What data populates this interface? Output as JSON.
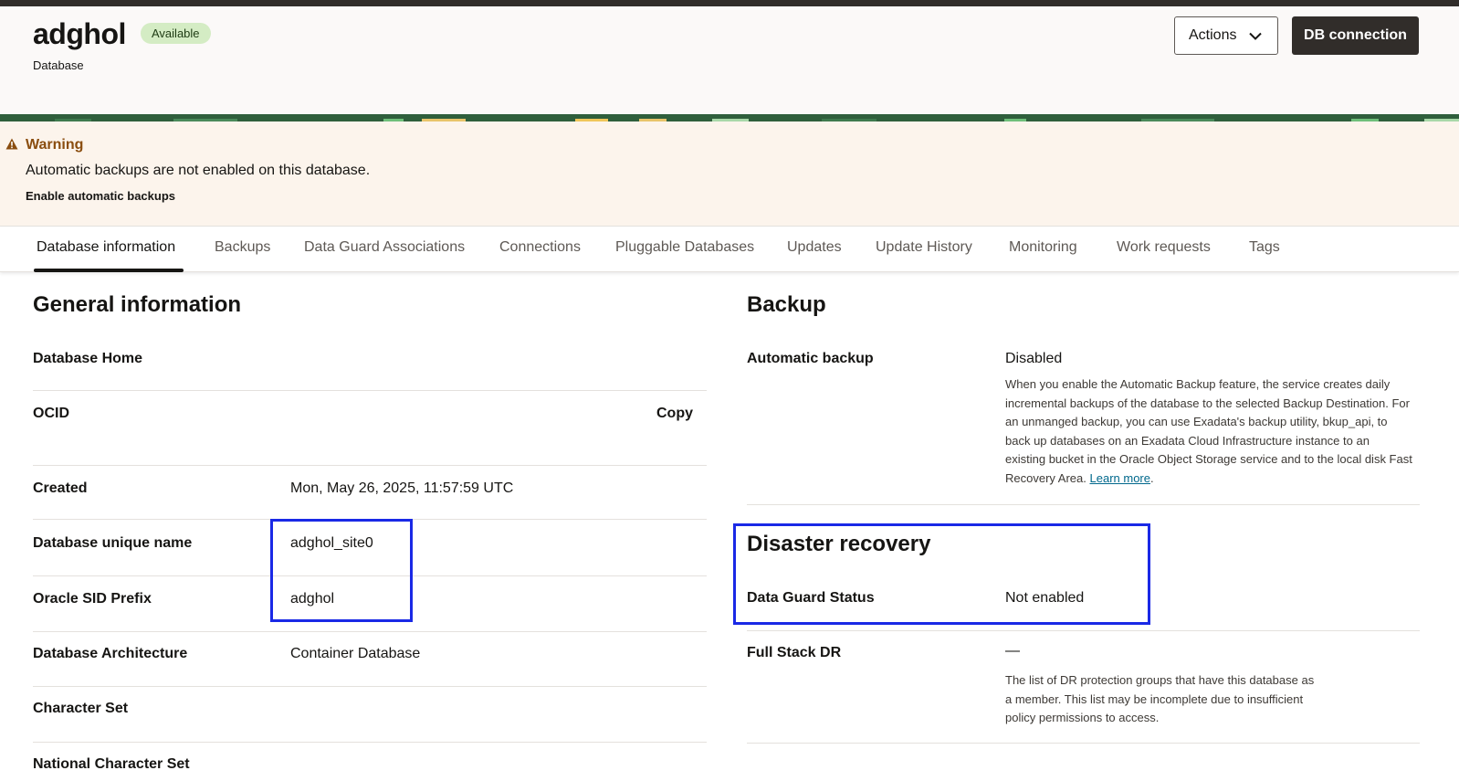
{
  "header": {
    "title": "adghol",
    "status": "Available",
    "subtitle": "Database",
    "actions_label": "Actions",
    "db_connection_label": "DB connection"
  },
  "warning": {
    "title": "Warning",
    "message": "Automatic backups are not enabled on this database.",
    "link": "Enable automatic backups"
  },
  "tabs": [
    {
      "label": "Database information"
    },
    {
      "label": "Backups"
    },
    {
      "label": "Data Guard Associations"
    },
    {
      "label": "Connections"
    },
    {
      "label": "Pluggable Databases"
    },
    {
      "label": "Updates"
    },
    {
      "label": "Update History"
    },
    {
      "label": "Monitoring"
    },
    {
      "label": "Work requests"
    },
    {
      "label": "Tags"
    }
  ],
  "general": {
    "heading": "General information",
    "database_home_label": "Database Home",
    "ocid_label": "OCID",
    "copy_label": "Copy",
    "created_label": "Created",
    "created_value": "Mon, May 26, 2025, 11:57:59 UTC",
    "unique_name_label": "Database unique name",
    "unique_name_value": "adghol_site0",
    "sid_label": "Oracle SID Prefix",
    "sid_value": "adghol",
    "architecture_label": "Database Architecture",
    "architecture_value": "Container Database",
    "charset_label": "Character Set",
    "ncharset_label": "National Character Set"
  },
  "backup": {
    "heading": "Backup",
    "auto_label": "Automatic backup",
    "auto_value": "Disabled",
    "help_text": "When you enable the Automatic Backup feature, the service creates daily incremental backups of the database to the selected Backup Destination. For an unmanged backup, you can use Exadata's backup utility, bkup_api, to back up databases on an Exadata Cloud Infrastructure instance to an existing bucket in the Oracle Object Storage service and to the local disk Fast Recovery Area.",
    "learn_more": "Learn more"
  },
  "dr": {
    "heading": "Disaster recovery",
    "dg_label": "Data Guard Status",
    "dg_value": "Not enabled",
    "fsdr_label": "Full Stack DR",
    "fsdr_value": "—",
    "fsdr_help": "The list of DR protection groups that have this database as a member. This list may be incomplete due to insufficient policy permissions to access."
  },
  "colors": {
    "highlight": "#1a29e6",
    "dark": "#312d2a",
    "warning_bg": "#fcf4ec",
    "badge_bg": "#d4ecc4"
  }
}
